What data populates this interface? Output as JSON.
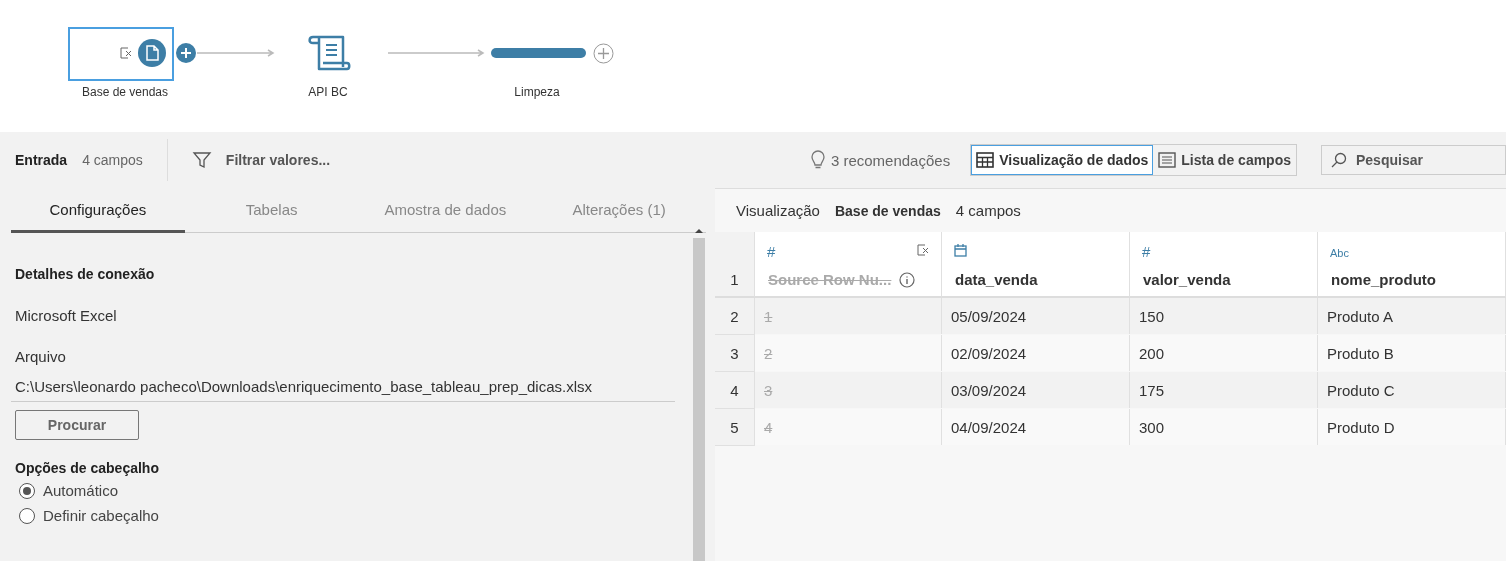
{
  "flow": {
    "nodes": [
      {
        "label": "Base de vendas",
        "kind": "input",
        "selected": true
      },
      {
        "label": "API BC",
        "kind": "script",
        "selected": false
      },
      {
        "label": "Limpeza",
        "kind": "clean",
        "selected": false
      }
    ]
  },
  "toolbar": {
    "title": "Entrada",
    "count": "4 campos",
    "filter": "Filtrar valores...",
    "recommendations": "3 recomendações",
    "view_buttons": [
      {
        "label": "Visualização de dados",
        "kind": "grid",
        "selected": true
      },
      {
        "label": "Lista de campos",
        "kind": "list",
        "selected": false
      }
    ],
    "search": {
      "placeholder": "Pesquisar"
    }
  },
  "tabs": [
    {
      "label": "Configurações",
      "selected": true
    },
    {
      "label": "Tabelas",
      "selected": false
    },
    {
      "label": "Amostra de dados",
      "selected": false
    },
    {
      "label": "Alterações (1)",
      "selected": false
    }
  ],
  "settings": {
    "section_title": "Detalhes de conexão",
    "connection_type": "Microsoft Excel",
    "file_label": "Arquivo",
    "file_path": "C:\\Users\\leonardo pacheco\\Downloads\\enriquecimento_base_tableau_prep_dicas.xlsx",
    "browse_button": "Procurar",
    "header_options": {
      "title": "Opções de cabeçalho",
      "options": [
        {
          "label": "Automático",
          "selected": true
        },
        {
          "label": "Definir cabeçalho",
          "selected": false
        }
      ]
    }
  },
  "preview": {
    "label": "Visualização",
    "name": "Base de vendas",
    "count": "4 campos",
    "header_row_number": "1",
    "columns": [
      {
        "name": "Source Row Nu...",
        "kind": "number",
        "type_label": "#",
        "excluded": true
      },
      {
        "name": "data_venda",
        "kind": "date",
        "excluded": false
      },
      {
        "name": "valor_venda",
        "kind": "number",
        "type_label": "#",
        "excluded": false
      },
      {
        "name": "nome_produto",
        "kind": "string",
        "type_label": "Abc",
        "excluded": false
      }
    ],
    "rows": [
      {
        "row_number": "2",
        "cells": [
          "1",
          "05/09/2024",
          "150",
          "Produto A"
        ]
      },
      {
        "row_number": "3",
        "cells": [
          "2",
          "02/09/2024",
          "200",
          "Produto B"
        ]
      },
      {
        "row_number": "4",
        "cells": [
          "3",
          "03/09/2024",
          "175",
          "Produto C"
        ]
      },
      {
        "row_number": "5",
        "cells": [
          "4",
          "04/09/2024",
          "300",
          "Produto D"
        ]
      }
    ]
  }
}
